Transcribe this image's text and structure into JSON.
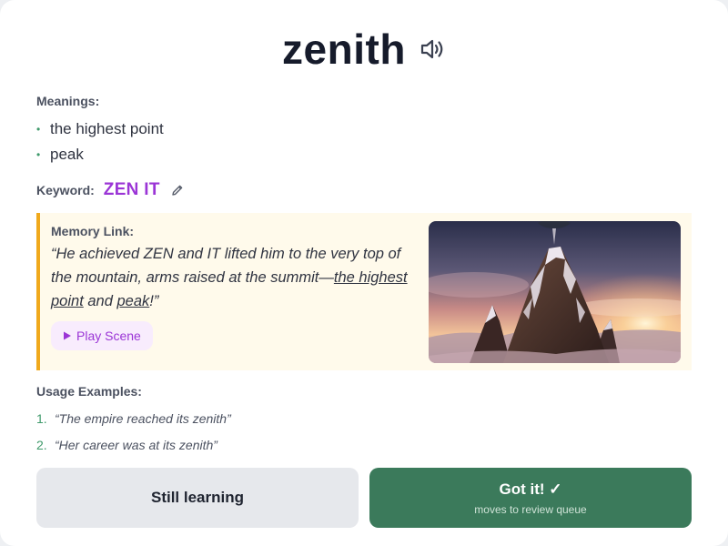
{
  "colors": {
    "accent_purple": "#9b35d6",
    "accent_green": "#3b7a5b",
    "memory_border": "#f0a91c",
    "memory_bg": "#fffaeb"
  },
  "card": {
    "word": "zenith",
    "speaker_icon": "speaker-icon",
    "meanings_label": "Meanings:",
    "meanings": [
      "the highest point",
      "peak"
    ],
    "keyword_label": "Keyword:",
    "keyword": "ZEN IT",
    "edit_icon": "pencil-icon",
    "memory": {
      "label": "Memory Link:",
      "text_1": "“He achieved ZEN and IT lifted him to the very top of the mountain, arms raised at the summit—",
      "highlight_1": "the highest point",
      "text_2": " and ",
      "highlight_2": "peak",
      "text_3": "!”",
      "play_label": "Play Scene",
      "play_icon": "play-icon"
    },
    "usage_label": "Usage Examples:",
    "usage": [
      {
        "num": "1.",
        "text": "“The empire reached its zenith”"
      },
      {
        "num": "2.",
        "text": "“Her career was at its zenith”"
      }
    ],
    "actions": {
      "still_learning": "Still learning",
      "got_it": "Got it! ✓",
      "got_it_sub": "moves to review queue"
    }
  }
}
